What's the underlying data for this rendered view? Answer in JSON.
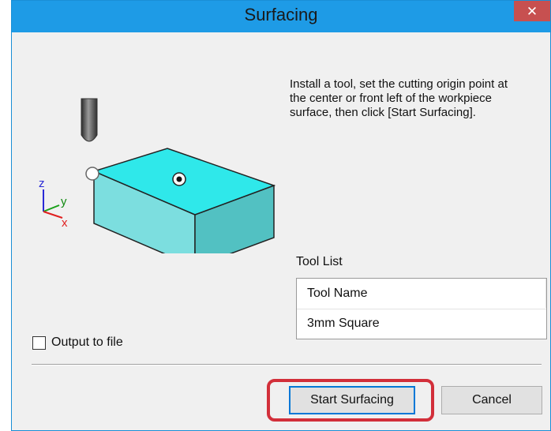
{
  "window": {
    "title": "Surfacing",
    "close_glyph": "✕"
  },
  "illustration": {
    "axes": {
      "z": "z",
      "y": "y",
      "x": "x"
    },
    "colors": {
      "top_face": "#2fe8ea",
      "front_face": "#7cdedf",
      "side_face": "#52c1c2",
      "tool": "#555555"
    }
  },
  "instructions": "Install a tool, set the cutting origin point at the center or front left of the workpiece surface, then click [Start Surfacing].",
  "tool_list": {
    "label": "Tool List",
    "column_header": "Tool Name",
    "rows": [
      "3mm Square"
    ]
  },
  "output_to_file": {
    "label": "Output to file",
    "checked": false
  },
  "buttons": {
    "start": "Start Surfacing",
    "cancel": "Cancel"
  },
  "colors": {
    "titlebar": "#1e9be6",
    "close": "#c75050",
    "highlight": "#d22f3a"
  }
}
